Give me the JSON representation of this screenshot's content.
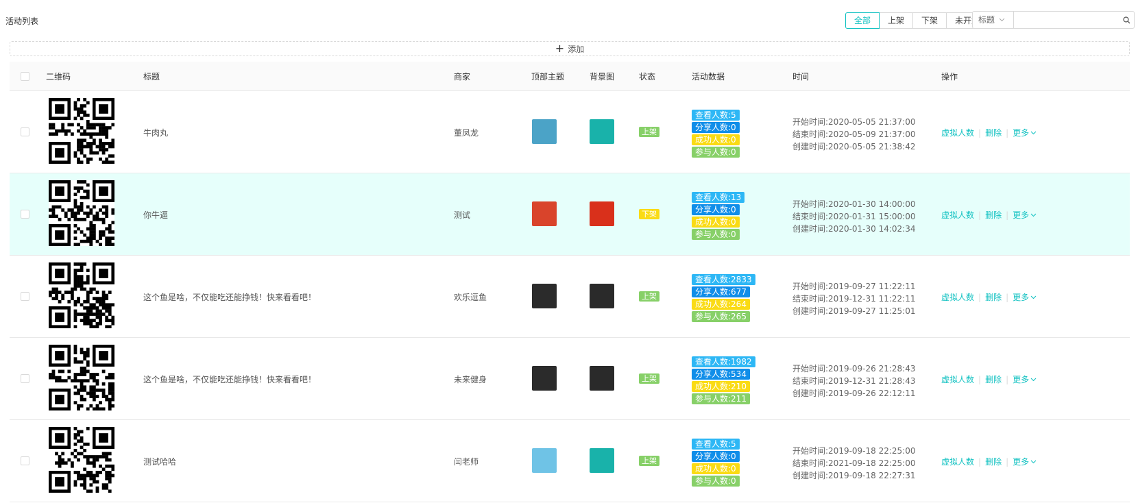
{
  "page_title": "活动列表",
  "filters": {
    "tabs": [
      "全部",
      "上架",
      "下架",
      "未开始"
    ],
    "active": 0
  },
  "search": {
    "field": "标题",
    "placeholder": ""
  },
  "add_label": "添加",
  "columns": [
    "二维码",
    "标题",
    "商家",
    "顶部主题",
    "背景图",
    "状态",
    "活动数据",
    "时间",
    "操作"
  ],
  "colors": {
    "accent": "#13c2c2",
    "view": "#2db7f5",
    "share": "#108ee9",
    "success": "#fadb14",
    "join": "#87d068",
    "on": "#87d068",
    "off": "#fadb14"
  },
  "rows": [
    {
      "title": "牛肉丸",
      "merchant": "董凤龙",
      "theme_color": "#4ba3c7",
      "bg_color": "#19b2aa",
      "status": "上架",
      "status_type": "on",
      "stats": [
        "查看人数:5",
        "分享人数:0",
        "成功人数:0",
        "参与人数:0"
      ],
      "times": [
        "开始时间:2020-05-05 21:37:00",
        "结束时间:2020-05-09 21:37:00",
        "创建时间:2020-05-05 21:38:42"
      ],
      "ops": [
        "虚拟人数",
        "删除",
        "更多"
      ],
      "highlight": false
    },
    {
      "title": "你牛逼",
      "merchant": "测试",
      "theme_color": "#d9442b",
      "bg_color": "#d9301b",
      "status": "下架",
      "status_type": "off",
      "stats": [
        "查看人数:13",
        "分享人数:0",
        "成功人数:0",
        "参与人数:0"
      ],
      "times": [
        "开始时间:2020-01-30 14:00:00",
        "结束时间:2020-01-31 15:00:00",
        "创建时间:2020-01-30 14:02:34"
      ],
      "ops": [
        "虚拟人数",
        "删除",
        "更多"
      ],
      "highlight": true
    },
    {
      "title": "这个鱼是啥，不仅能吃还能挣钱！快来看看吧！",
      "merchant": "欢乐逗鱼",
      "theme_color": "#2b2b2b",
      "bg_color": "#2a2a2a",
      "status": "上架",
      "status_type": "on",
      "stats": [
        "查看人数:2833",
        "分享人数:677",
        "成功人数:264",
        "参与人数:265"
      ],
      "times": [
        "开始时间:2019-09-27 11:22:11",
        "结束时间:2019-12-31 11:22:11",
        "创建时间:2019-09-27 11:25:01"
      ],
      "ops": [
        "虚拟人数",
        "删除",
        "更多"
      ],
      "highlight": false
    },
    {
      "title": "这个鱼是啥，不仅能吃还能挣钱！快来看看吧！",
      "merchant": "未来健身",
      "theme_color": "#2b2b2b",
      "bg_color": "#2a2a2a",
      "status": "上架",
      "status_type": "on",
      "stats": [
        "查看人数:1982",
        "分享人数:534",
        "成功人数:210",
        "参与人数:211"
      ],
      "times": [
        "开始时间:2019-09-26 21:28:43",
        "结束时间:2019-12-31 21:28:43",
        "创建时间:2019-09-26 22:12:11"
      ],
      "ops": [
        "虚拟人数",
        "删除",
        "更多"
      ],
      "highlight": false
    },
    {
      "title": "测试哈哈",
      "merchant": "闫老师",
      "theme_color": "#6fc3e6",
      "bg_color": "#19b2aa",
      "status": "上架",
      "status_type": "on",
      "stats": [
        "查看人数:5",
        "分享人数:0",
        "成功人数:0",
        "参与人数:0"
      ],
      "times": [
        "开始时间:2019-09-18 22:25:00",
        "结束时间:2021-09-18 22:25:00",
        "创建时间:2019-09-18 22:27:31"
      ],
      "ops": [
        "虚拟人数",
        "删除",
        "更多"
      ],
      "highlight": false
    }
  ]
}
